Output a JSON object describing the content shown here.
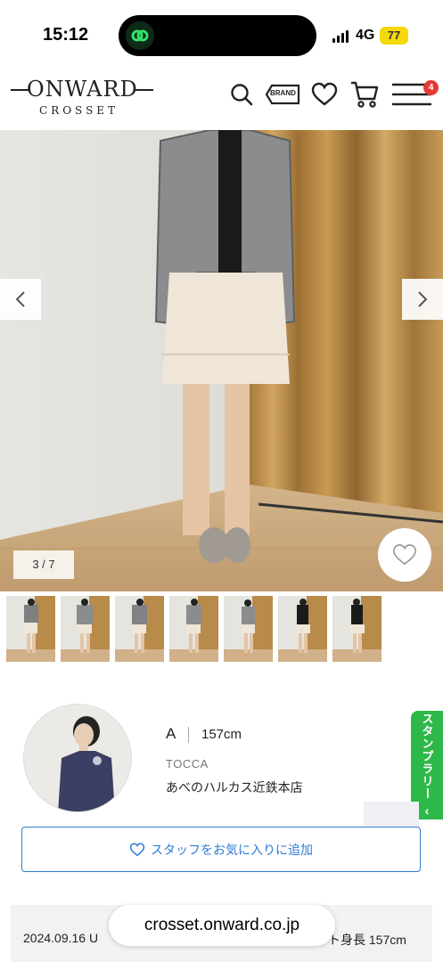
{
  "status_bar": {
    "time": "15:12",
    "network": "4G",
    "battery": "77"
  },
  "header": {
    "logo_main": "ONWARD",
    "logo_sub": "CROSSET",
    "brand_label": "BRAND",
    "cart_badge": "4",
    "icons": [
      "search-icon",
      "brand-tag-icon",
      "heart-icon",
      "cart-icon",
      "menu-icon"
    ]
  },
  "gallery": {
    "counter": "3 / 7",
    "thumbnail_count": 7
  },
  "staff": {
    "name": "A",
    "height": "157cm",
    "brand": "TOCCA",
    "store": "あべのハルカス近鉄本店"
  },
  "stamp_rally": {
    "label": "スタンプラリー",
    "chevron": "‹"
  },
  "favorite_staff_button": {
    "label": "スタッフをお気に入りに追加"
  },
  "post": {
    "date": "2024.09.16 U",
    "height_text": "ト身長 157cm"
  },
  "browser": {
    "url": "crosset.onward.co.jp"
  },
  "colors": {
    "accent": "#2d7bd6",
    "stamp": "#2fb84a",
    "badge": "#e53935"
  }
}
